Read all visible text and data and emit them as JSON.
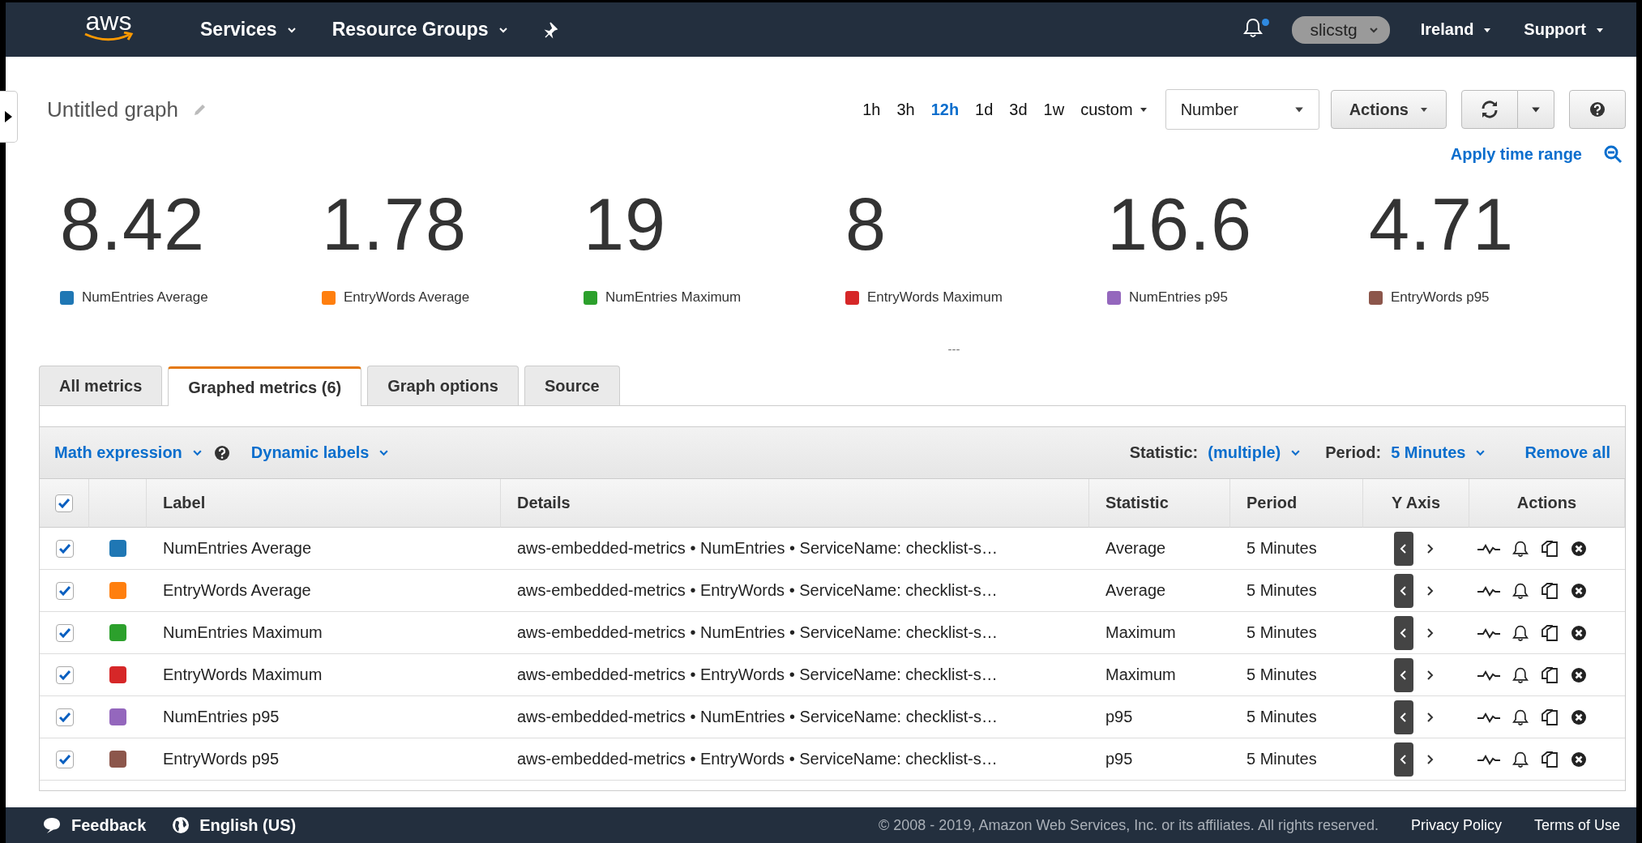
{
  "nav": {
    "logo": "aws",
    "menus": [
      {
        "label": "Services"
      },
      {
        "label": "Resource Groups"
      }
    ],
    "has_unread": true,
    "account": "slicstg",
    "region": "Ireland",
    "support": "Support"
  },
  "graph": {
    "title": "Untitled graph",
    "time_ranges": [
      {
        "label": "1h",
        "selected": false
      },
      {
        "label": "3h",
        "selected": false
      },
      {
        "label": "12h",
        "selected": true
      },
      {
        "label": "1d",
        "selected": false
      },
      {
        "label": "3d",
        "selected": false
      },
      {
        "label": "1w",
        "selected": false
      }
    ],
    "custom": "custom",
    "view": "Number",
    "actions": "Actions",
    "apply": "Apply time range"
  },
  "stats": [
    {
      "value": "8.42",
      "label": "NumEntries Average",
      "color": "#1f77b4"
    },
    {
      "value": "1.78",
      "label": "EntryWords Average",
      "color": "#ff7f0e"
    },
    {
      "value": "19",
      "label": "NumEntries Maximum",
      "color": "#2ca02c"
    },
    {
      "value": "8",
      "label": "EntryWords Maximum",
      "color": "#d62728"
    },
    {
      "value": "16.6",
      "label": "NumEntries p95",
      "color": "#9467bd"
    },
    {
      "value": "4.71",
      "label": "EntryWords p95",
      "color": "#8c564b"
    }
  ],
  "resize_handle": "---",
  "tabs": [
    {
      "label": "All metrics",
      "selected": false
    },
    {
      "label": "Graphed metrics (6)",
      "selected": true
    },
    {
      "label": "Graph options",
      "selected": false
    },
    {
      "label": "Source",
      "selected": false
    }
  ],
  "toolbar": {
    "math": "Math expression",
    "dynamic": "Dynamic labels",
    "statistic_label": "Statistic:",
    "statistic": "(multiple)",
    "period_label": "Period:",
    "period": "5 Minutes",
    "remove": "Remove all"
  },
  "table": {
    "all_checked": true,
    "columns": [
      "Label",
      "Details",
      "Statistic",
      "Period",
      "Y Axis",
      "Actions"
    ],
    "rows": [
      {
        "checked": true,
        "color": "#1f77b4",
        "label": "NumEntries Average",
        "details": "aws-embedded-metrics • NumEntries • ServiceName: checklist-s…",
        "statistic": "Average",
        "period": "5 Minutes",
        "left_axis": true
      },
      {
        "checked": true,
        "color": "#ff7f0e",
        "label": "EntryWords Average",
        "details": "aws-embedded-metrics • EntryWords • ServiceName: checklist-s…",
        "statistic": "Average",
        "period": "5 Minutes",
        "left_axis": true
      },
      {
        "checked": true,
        "color": "#2ca02c",
        "label": "NumEntries Maximum",
        "details": "aws-embedded-metrics • NumEntries • ServiceName: checklist-s…",
        "statistic": "Maximum",
        "period": "5 Minutes",
        "left_axis": true
      },
      {
        "checked": true,
        "color": "#d62728",
        "label": "EntryWords Maximum",
        "details": "aws-embedded-metrics • EntryWords • ServiceName: checklist-s…",
        "statistic": "Maximum",
        "period": "5 Minutes",
        "left_axis": true
      },
      {
        "checked": true,
        "color": "#9467bd",
        "label": "NumEntries p95",
        "details": "aws-embedded-metrics • NumEntries • ServiceName: checklist-s…",
        "statistic": "p95",
        "period": "5 Minutes",
        "left_axis": true
      },
      {
        "checked": true,
        "color": "#8c564b",
        "label": "EntryWords p95",
        "details": "aws-embedded-metrics • EntryWords • ServiceName: checklist-s…",
        "statistic": "p95",
        "period": "5 Minutes",
        "left_axis": true
      }
    ]
  },
  "footer": {
    "feedback": "Feedback",
    "language": "English (US)",
    "copyright": "© 2008 - 2019, Amazon Web Services, Inc. or its affiliates. All rights reserved.",
    "links": [
      "Privacy Policy",
      "Terms of Use"
    ]
  }
}
